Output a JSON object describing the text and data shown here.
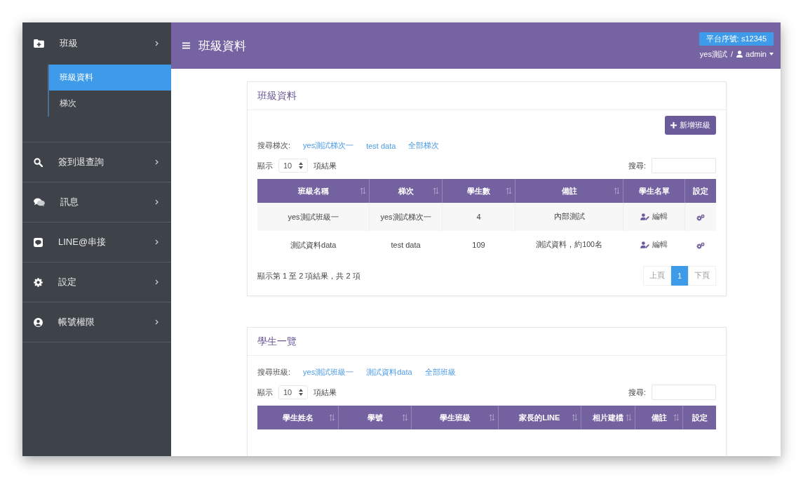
{
  "sidebar": {
    "items": [
      {
        "label": "班級",
        "children": [
          {
            "label": "班級資料",
            "selected": true
          },
          {
            "label": "梯次",
            "selected": false
          }
        ]
      },
      {
        "label": "簽到退查詢"
      },
      {
        "label": "訊息"
      },
      {
        "label": "LINE@串接"
      },
      {
        "label": "設定"
      },
      {
        "label": "帳號權限"
      }
    ]
  },
  "header": {
    "title": "班級資料",
    "serial_badge": "平台序號: s12345",
    "site": "yes測試",
    "separator": "/",
    "user": "admin"
  },
  "class_card": {
    "title": "班級資料",
    "add_button": "新增班級",
    "filter": {
      "label": "搜尋梯次:",
      "links": [
        "yes測試梯次一",
        "test data",
        "全部梯次"
      ]
    },
    "page_length": {
      "before": "顯示",
      "value": "10",
      "after": "項結果"
    },
    "search_label": "搜尋:",
    "table": {
      "columns": [
        {
          "label": "班級名稱",
          "sortable": true
        },
        {
          "label": "梯次",
          "sortable": true
        },
        {
          "label": "學生數",
          "sortable": true
        },
        {
          "label": "備註",
          "sortable": true
        },
        {
          "label": "學生名單",
          "sortable": false
        },
        {
          "label": "設定",
          "sortable": false
        }
      ],
      "rows": [
        {
          "cells": [
            "yes測試班級一",
            "yes測試梯次一",
            "4",
            "內部測試"
          ],
          "edit": "編輯"
        },
        {
          "cells": [
            "測試資料data",
            "test data",
            "109",
            "測試資料，約100名"
          ],
          "edit": "編輯"
        }
      ]
    },
    "info": "顯示第 1 至 2 項結果，共 2 項",
    "pagination": [
      {
        "label": "上頁",
        "selected": false
      },
      {
        "label": "1",
        "selected": true
      },
      {
        "label": "下頁",
        "selected": false
      }
    ]
  },
  "student_card": {
    "title": "學生一覽",
    "filter": {
      "label": "搜尋班級:",
      "links": [
        "yes測試班級一",
        "測試資料data",
        "全部班級"
      ]
    },
    "page_length": {
      "before": "顯示",
      "value": "10",
      "after": "項結果"
    },
    "search_label": "搜尋:",
    "table": {
      "columns": [
        {
          "label": "學生姓名",
          "sortable": true
        },
        {
          "label": "學號",
          "sortable": true
        },
        {
          "label": "學生班級",
          "sortable": true
        },
        {
          "label": "家長的LINE",
          "sortable": true
        },
        {
          "label": "相片建檔",
          "sortable": true
        },
        {
          "label": "備註",
          "sortable": true
        },
        {
          "label": "設定",
          "sortable": false
        }
      ]
    }
  }
}
